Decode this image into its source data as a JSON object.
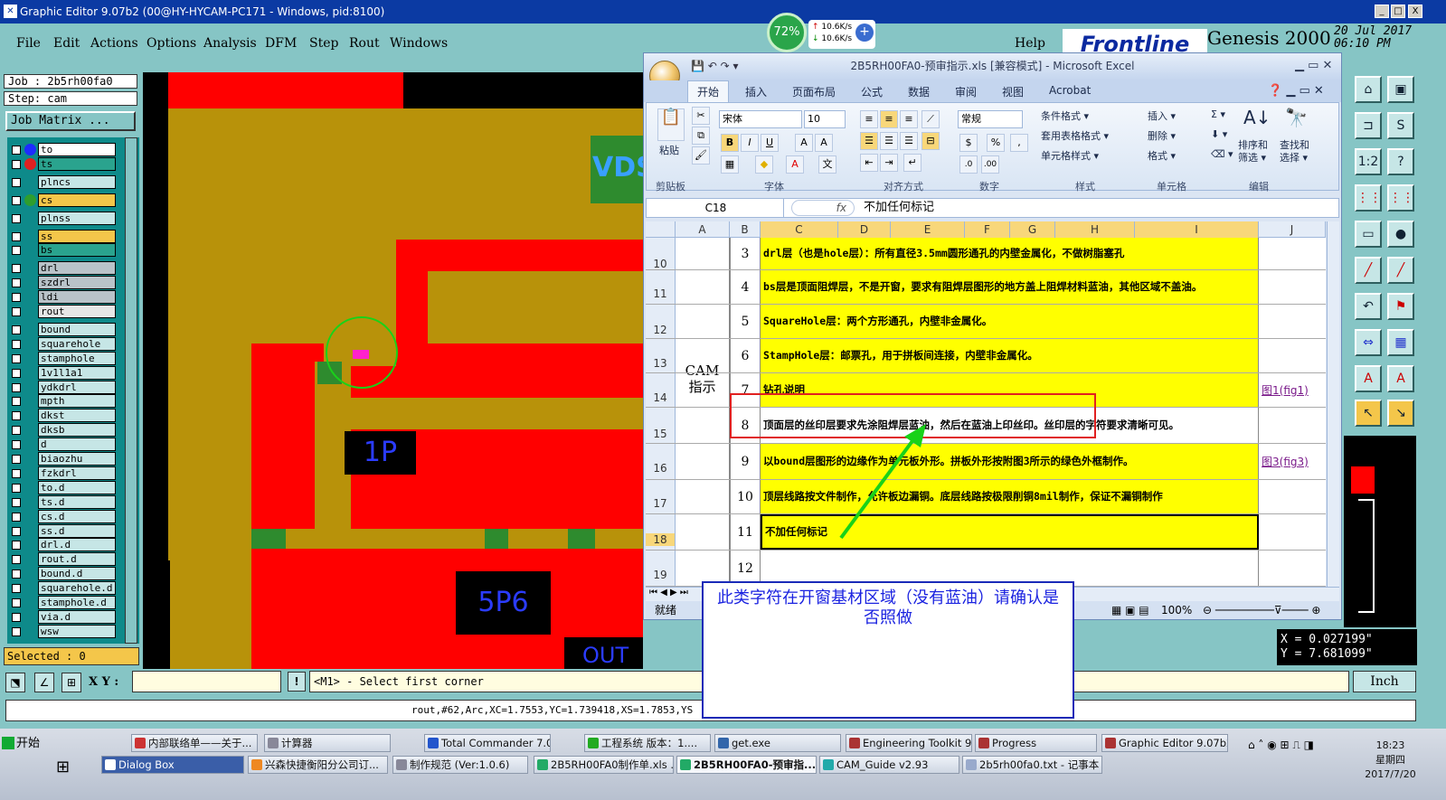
{
  "window": {
    "title": "Graphic Editor 9.07b2 (00@HY-HYCAM-PC171 - Windows, pid:8100)",
    "min": "_",
    "max": "□",
    "close": "X"
  },
  "menu": [
    "File",
    "Edit",
    "Actions",
    "Options",
    "Analysis",
    "DFM",
    "Step",
    "Rout",
    "Windows"
  ],
  "help": "Help",
  "brand": {
    "logo": "Frontline",
    "product": "Genesis 2000",
    "date": "20 Jul 2017",
    "time": "06:10 PM"
  },
  "net": {
    "percent": "72%",
    "up": "10.6K/s",
    "down": "10.6K/s",
    "plus": "+"
  },
  "job": {
    "job": "Job : 2b5rh00fa0",
    "step": "Step: cam",
    "matrix": "Job Matrix ..."
  },
  "layers": [
    {
      "name": "to",
      "dot": "#1d2cff",
      "hl": "#ffffff"
    },
    {
      "name": "ts",
      "dot": "#e02020",
      "hl": "#2aa38e"
    },
    {
      "name": "plncs",
      "dot": "",
      "hl": "#c6e6e6"
    },
    {
      "name": "cs",
      "dot": "#2e9e2e",
      "hl": "#f4c64a"
    },
    {
      "name": "plnss",
      "dot": "",
      "hl": "#c6e6e6"
    },
    {
      "name": "ss",
      "dot": "",
      "hl": "#f4c64a"
    },
    {
      "name": "bs",
      "dot": "",
      "hl": "#2aa38e"
    },
    {
      "name": "drl",
      "dot": "",
      "hl": "#b9c3c9"
    },
    {
      "name": "szdrl",
      "dot": "",
      "hl": "#b9c3c9"
    },
    {
      "name": "ldi",
      "dot": "",
      "hl": "#b9c3c9"
    },
    {
      "name": "rout",
      "dot": "",
      "hl": "#e6e6e6"
    },
    {
      "name": "bound",
      "dot": "",
      "hl": "#c6e6e6"
    },
    {
      "name": "squarehole",
      "dot": "",
      "hl": "#c6e6e6"
    },
    {
      "name": "stamphole",
      "dot": "",
      "hl": "#c6e6e6"
    },
    {
      "name": "1v1l1a1",
      "dot": "",
      "hl": "#c6e6e6"
    },
    {
      "name": "ydkdrl",
      "dot": "",
      "hl": "#c6e6e6"
    },
    {
      "name": "mpth",
      "dot": "",
      "hl": "#c6e6e6"
    },
    {
      "name": "dkst",
      "dot": "",
      "hl": "#c6e6e6"
    },
    {
      "name": "dksb",
      "dot": "",
      "hl": "#c6e6e6"
    },
    {
      "name": "d",
      "dot": "",
      "hl": "#c6e6e6"
    },
    {
      "name": "biaozhu",
      "dot": "",
      "hl": "#c6e6e6"
    },
    {
      "name": "fzkdrl",
      "dot": "",
      "hl": "#c6e6e6"
    },
    {
      "name": "to.d",
      "dot": "",
      "hl": "#c6e6e6"
    },
    {
      "name": "ts.d",
      "dot": "",
      "hl": "#c6e6e6"
    },
    {
      "name": "cs.d",
      "dot": "",
      "hl": "#c6e6e6"
    },
    {
      "name": "ss.d",
      "dot": "",
      "hl": "#c6e6e6"
    },
    {
      "name": "drl.d",
      "dot": "",
      "hl": "#c6e6e6"
    },
    {
      "name": "rout.d",
      "dot": "",
      "hl": "#c6e6e6"
    },
    {
      "name": "bound.d",
      "dot": "",
      "hl": "#c6e6e6"
    },
    {
      "name": "squarehole.d",
      "dot": "",
      "hl": "#c6e6e6"
    },
    {
      "name": "stamphole.d",
      "dot": "",
      "hl": "#c6e6e6"
    },
    {
      "name": "via.d",
      "dot": "",
      "hl": "#c6e6e6"
    },
    {
      "name": "wsw",
      "dot": "",
      "hl": "#c6e6e6"
    }
  ],
  "selected": "Selected : 0",
  "canvas_labels": {
    "vds": "VDS",
    "p1": "1P",
    "p5": "5P6",
    "out": "OUT"
  },
  "coords": {
    "x": "X = 0.027199\"",
    "y": "Y = 7.681099\""
  },
  "xy_label": "X Y :",
  "xy_value": "",
  "prompt": "<M1> - Select first corner",
  "units": "Inch",
  "status_line": "rout,#62,Arc,XC=1.7553,YC=1.739418,XS=1.7853,YS",
  "excel": {
    "title": "2B5RH00FA0-预审指示.xls  [兼容模式] - Microsoft Excel",
    "tabs": [
      "开始",
      "插入",
      "页面布局",
      "公式",
      "数据",
      "审阅",
      "视图",
      "Acrobat"
    ],
    "font": "宋体",
    "size": "10",
    "numfmt": "常规",
    "groups": [
      "剪贴板",
      "字体",
      "对齐方式",
      "数字",
      "样式",
      "单元格",
      "编辑"
    ],
    "paste": "粘贴",
    "styles": [
      "条件格式 ▾",
      "套用表格格式 ▾",
      "单元格样式 ▾"
    ],
    "cells_btns": [
      "插入 ▾",
      "删除 ▾",
      "格式 ▾"
    ],
    "edit_btns": [
      "排序和\n筛选 ▾",
      "查找和\n选择 ▾"
    ],
    "namebox": "C18",
    "fx": "fx",
    "formula": "不加任何标记",
    "cols": [
      "A",
      "B",
      "C",
      "D",
      "E",
      "F",
      "G",
      "H",
      "I",
      "J"
    ],
    "rows": [
      "10",
      "11",
      "12",
      "13",
      "14",
      "15",
      "16",
      "17",
      "18",
      "19"
    ],
    "cam": "CAM\n指示",
    "items": [
      {
        "n": "3",
        "text": "drl层（也是hole层）：所有直径3.5mm圆形通孔的内壁金属化，不做树脂塞孔",
        "link": ""
      },
      {
        "n": "4",
        "text": "bs层是顶面阻焊层，不是开窗，要求有阻焊层图形的地方盖上阻焊材料蓝油，其他区域不盖油。",
        "link": ""
      },
      {
        "n": "5",
        "text": "SquareHole层：两个方形通孔，内壁非金属化。",
        "link": ""
      },
      {
        "n": "6",
        "text": "StampHole层：邮票孔，用于拼板间连接，内壁非金属化。",
        "link": ""
      },
      {
        "n": "7",
        "text": "钻孔说明",
        "link": "图1(fig1)"
      },
      {
        "n": "8",
        "text": "顶面层的丝印层要求先涂阻焊层蓝油，然后在蓝油上印丝印。丝印层的字符要求清晰可见。",
        "link": ""
      },
      {
        "n": "9",
        "text": "以bound层图形的边缘作为单元板外形。拼板外形按附图3所示的绿色外框制作。",
        "link": "图3(fig3)"
      },
      {
        "n": "10",
        "text": "顶层线路按文件制作，允许板边漏铜。底层线路按极限削铜8mil制作，保证不漏铜制作",
        "link": ""
      },
      {
        "n": "11",
        "text": "不加任何标记",
        "link": ""
      },
      {
        "n": "12",
        "text": "",
        "link": ""
      }
    ],
    "status": "就绪",
    "zoom": "100%"
  },
  "callout": "此类字符在开窗基材区域（没有蓝油）请确认是否照做",
  "taskbar": {
    "start": "开始",
    "row1": [
      "内部联络单——关于...",
      "计算器",
      "Total Commander 7.0...",
      "工程系统  版本：1....",
      "get.exe",
      "Engineering Toolkit 9....",
      "Progress",
      "Graphic Editor 9.07b2..."
    ],
    "row2": [
      "Dialog Box",
      "兴森快捷衡阳分公司订...",
      "制作规范 (Ver:1.0.6)",
      "2B5RH00FA0制作单.xls ...",
      "2B5RH00FA0-预审指...",
      "CAM_Guide v2.93",
      "2b5rh00fa0.txt - 记事本"
    ],
    "time": "18:23",
    "weekday": "星期四",
    "date": "2017/7/20"
  },
  "colors": {
    "board_red": "#ff0000",
    "board_gold": "#b8920a",
    "board_green": "#2e8b2e",
    "pad_magenta": "#ff22cc",
    "accent": "#0b3aa3"
  }
}
